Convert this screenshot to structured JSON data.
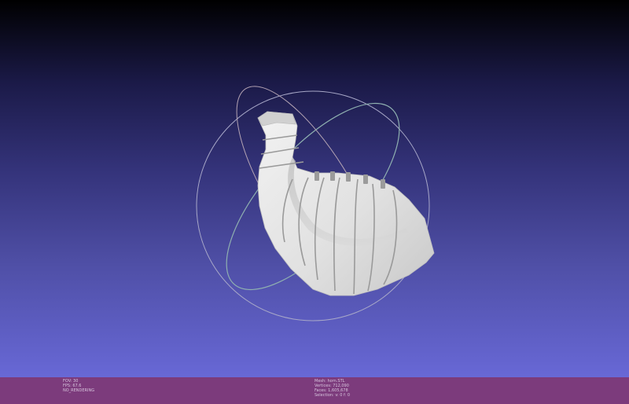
{
  "viewport": {
    "background_top": "#000000",
    "background_bottom": "#6868d6",
    "model_color": "#e6e6e6",
    "trackball_colors": [
      "#8fb0b0",
      "#b3a3b3",
      "#a8a8c8"
    ]
  },
  "status_bar": {
    "background": "#7c3b7c",
    "left_info": [
      "FOV: 30",
      "FPS:   67.6",
      "NO_RENDERING"
    ],
    "right_info": [
      "Mesh: horn.STL",
      "Vertices: 712,090",
      "Faces: 1,605,678",
      "Selection: v: 0 f: 0"
    ]
  }
}
